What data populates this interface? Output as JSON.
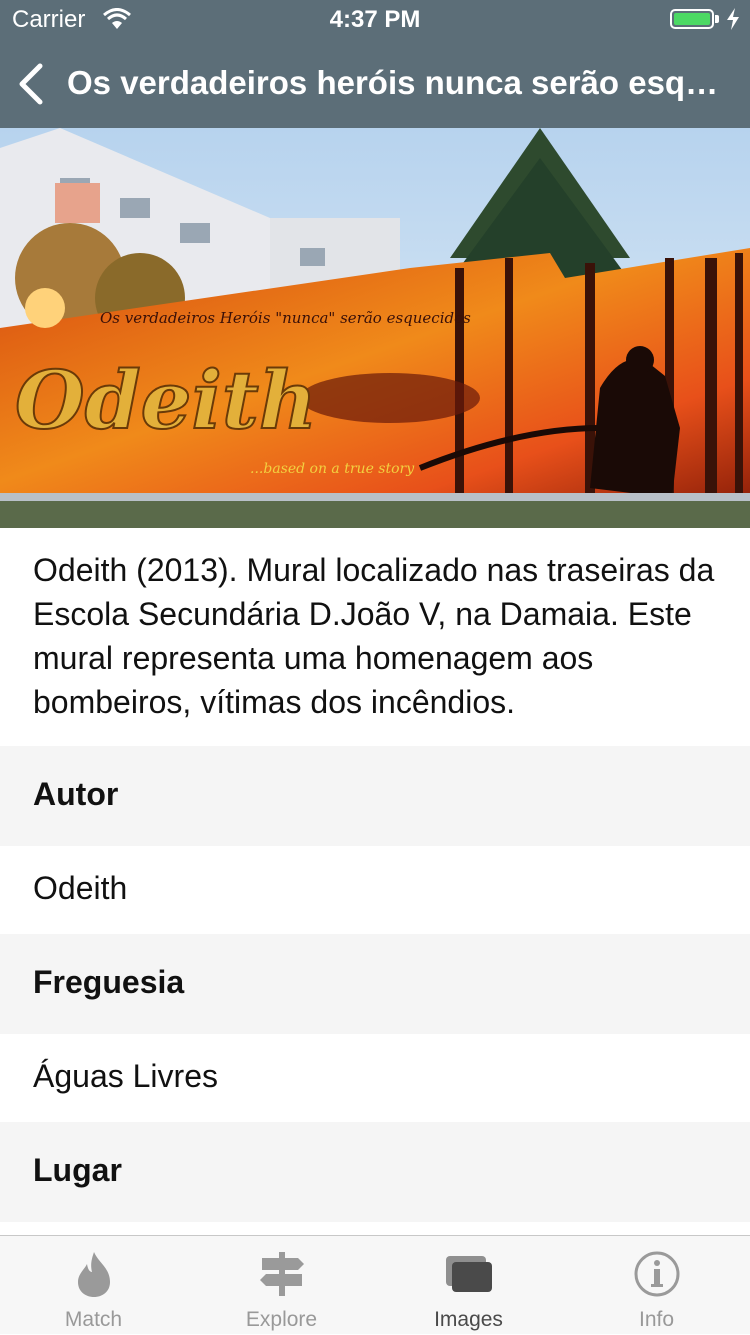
{
  "status_bar": {
    "carrier": "Carrier",
    "time": "4:37 PM"
  },
  "nav": {
    "title": "Os verdadeiros heróis nunca serão esquecidos"
  },
  "description": "Odeith (2013). Mural localizado nas traseiras da Escola Secundária D.João V, na Damaia. Este mural representa uma homenagem aos bombeiros, vítimas dos incêndios.",
  "sections": {
    "autor": {
      "label": "Autor",
      "value": "Odeith"
    },
    "freguesia": {
      "label": "Freguesia",
      "value": "Águas Livres"
    },
    "lugar": {
      "label": "Lugar"
    }
  },
  "tabs": [
    {
      "label": "Match",
      "icon": "flame-icon"
    },
    {
      "label": "Explore",
      "icon": "signpost-icon"
    },
    {
      "label": "Images",
      "icon": "images-icon",
      "active": true
    },
    {
      "label": "Info",
      "icon": "info-icon"
    }
  ],
  "colors": {
    "nav_bg": "#5c6e78",
    "battery": "#4cd964",
    "section_bg": "#f5f5f5"
  }
}
